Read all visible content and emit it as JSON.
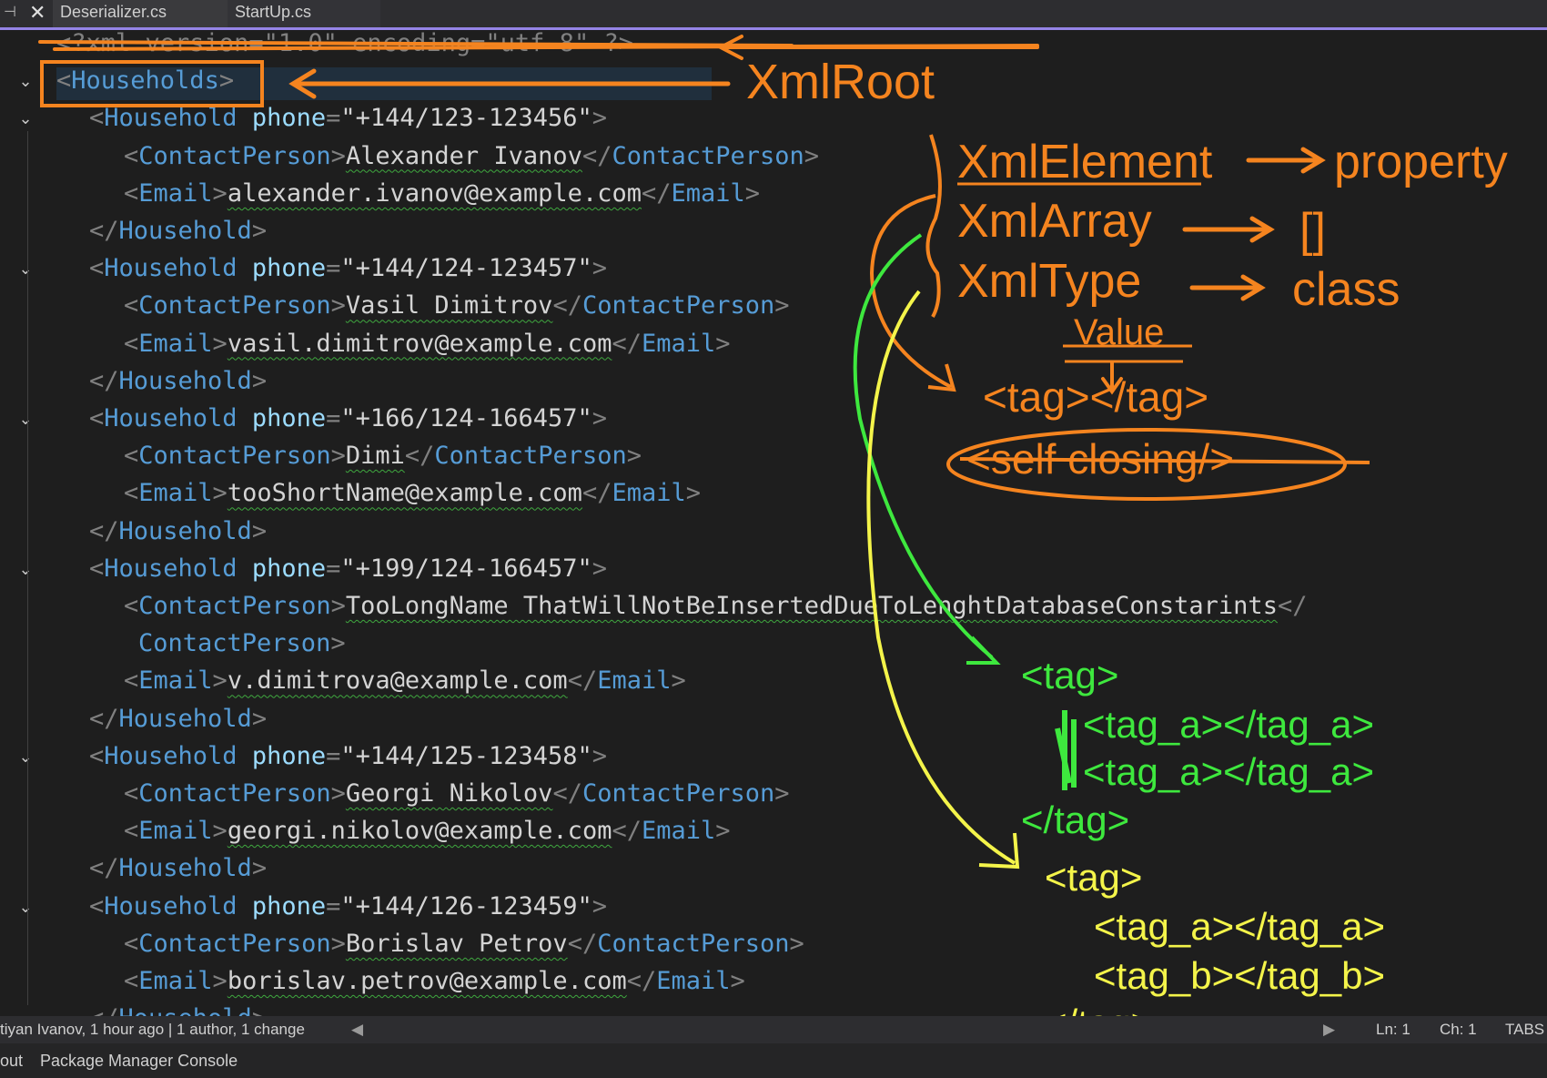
{
  "tabs": [
    {
      "label": "Deserializer.cs"
    },
    {
      "label": "StartUp.cs"
    }
  ],
  "editor": {
    "declaration": "<?xml version=\"1.0\" encoding=\"utf-8\" ?>",
    "root_tag": "Households",
    "household_tag": "Household",
    "phone_attr": "phone",
    "contact_tag": "ContactPerson",
    "email_tag": "Email",
    "households": [
      {
        "phone": "+144/123-123456",
        "contact": "Alexander Ivanov",
        "email": "alexander.ivanov@example.com"
      },
      {
        "phone": "+144/124-123457",
        "contact": "Vasil Dimitrov",
        "email": "vasil.dimitrov@example.com"
      },
      {
        "phone": "+166/124-166457",
        "contact": "Dimi",
        "email": "tooShortName@example.com"
      },
      {
        "phone": "+199/124-166457",
        "contact": "TooLongName ThatWillNotBeInsertedDueToLenghtDatabaseConstarints",
        "email": "v.dimitrova@example.com"
      },
      {
        "phone": "+144/125-123458",
        "contact": "Georgi Nikolov",
        "email": "georgi.nikolov@example.com"
      },
      {
        "phone": "+144/126-123459",
        "contact": "Borislav Petrov",
        "email": "borislav.petrov@example.com"
      }
    ]
  },
  "annotations": {
    "xml_root": "XmlRoot",
    "xml_element": "XmlElement",
    "property": "property",
    "xml_array": "XmlArray",
    "array_symbol": "[]",
    "xml_type": "XmlType",
    "class": "class",
    "value": "Value",
    "tag_pair": "<tag></tag>",
    "self_closing": "<self closing/>",
    "tag_open": "<tag>",
    "tag_a": "<tag_a></tag_a>",
    "tag_b": "<tag_b></tag_b>",
    "tag_close": "</tag>",
    "colors": {
      "orange": "#f5841f",
      "green": "#3ee83e",
      "yellow": "#f4f44a"
    }
  },
  "status": {
    "git": "tiyan Ivanov, 1 hour ago | 1 author, 1 change",
    "line": "Ln: 1",
    "char": "Ch: 1",
    "tabs": "TABS"
  },
  "bottom": {
    "output_tab": "out",
    "pmc_tab": "Package Manager Console"
  }
}
